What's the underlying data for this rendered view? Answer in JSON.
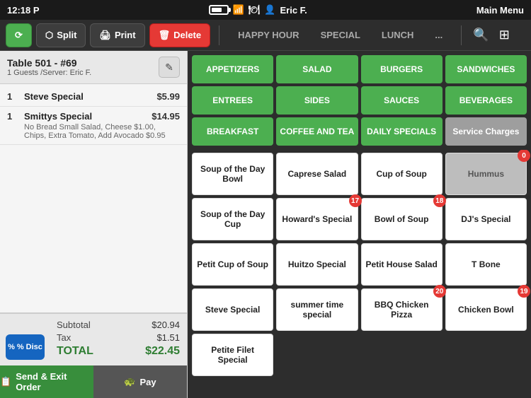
{
  "statusBar": {
    "time": "12:18 P",
    "battery": "70",
    "wifiIcon": "📶",
    "centerIcon": "🍽",
    "userIcon": "👤",
    "userName": "Eric F.",
    "menuTitle": "Main Menu"
  },
  "toolbar": {
    "splitLabel": "Split",
    "printLabel": "Print",
    "deleteLabel": "Delete",
    "tabs": [
      "HAPPY HOUR",
      "SPECIAL",
      "LUNCH",
      "..."
    ],
    "searchIcon": "🔍",
    "gridIcon": "⊞"
  },
  "order": {
    "tableLabel": "Table 501 - #69",
    "guestInfo": "1 Guests /Server: Eric F.",
    "items": [
      {
        "qty": "1",
        "name": "Steve Special",
        "price": "$5.99",
        "mods": ""
      },
      {
        "qty": "1",
        "name": "Smittys Special",
        "price": "$14.95",
        "mods": "No Bread Small Salad, Cheese $1.00, Chips, Extra Tomato, Add Avocado $0.95"
      }
    ],
    "subtotalLabel": "Subtotal",
    "subtotalValue": "$20.94",
    "taxLabel": "Tax",
    "taxValue": "$1.51",
    "totalLabel": "TOTAL",
    "totalValue": "$22.45",
    "discLabel": "% Disc",
    "sendLabel": "Send & Exit Order",
    "payLabel": "Pay"
  },
  "categories": [
    {
      "label": "APPETIZERS",
      "color": "green"
    },
    {
      "label": "SALAD",
      "color": "green"
    },
    {
      "label": "BURGERS",
      "color": "green"
    },
    {
      "label": "SANDWICHES",
      "color": "green"
    },
    {
      "label": "ENTREES",
      "color": "green"
    },
    {
      "label": "SIDES",
      "color": "green"
    },
    {
      "label": "SAUCES",
      "color": "green"
    },
    {
      "label": "BEVERAGES",
      "color": "green"
    },
    {
      "label": "BREAKFAST",
      "color": "green"
    },
    {
      "label": "COFFEE AND TEA",
      "color": "green"
    },
    {
      "label": "DAILY SPECIALS",
      "color": "green"
    },
    {
      "label": "Service Charges",
      "color": "grey"
    }
  ],
  "menuItems": [
    {
      "label": "Soup of the Day Bowl",
      "badge": null,
      "grey": false
    },
    {
      "label": "Caprese Salad",
      "badge": null,
      "grey": false
    },
    {
      "label": "Cup of Soup",
      "badge": null,
      "grey": false
    },
    {
      "label": "Hummus",
      "badge": "0",
      "grey": true
    },
    {
      "label": "Soup of the Day Cup",
      "badge": null,
      "grey": false
    },
    {
      "label": "Howard's Special",
      "badge": "17",
      "grey": false
    },
    {
      "label": "Bowl of Soup",
      "badge": "18",
      "grey": false
    },
    {
      "label": "DJ's Special",
      "badge": null,
      "grey": false
    },
    {
      "label": "Petit Cup of Soup",
      "badge": null,
      "grey": false
    },
    {
      "label": "Huitzo Special",
      "badge": null,
      "grey": false
    },
    {
      "label": "Petit House Salad",
      "badge": null,
      "grey": false
    },
    {
      "label": "T Bone",
      "badge": null,
      "grey": false
    },
    {
      "label": "Steve Special",
      "badge": null,
      "grey": false
    },
    {
      "label": "summer time special",
      "badge": null,
      "grey": false
    },
    {
      "label": "BBQ Chicken Pizza",
      "badge": "20",
      "grey": false
    },
    {
      "label": "Chicken Bowl",
      "badge": "19",
      "grey": false
    },
    {
      "label": "Petite Filet Special",
      "badge": null,
      "grey": false
    }
  ]
}
